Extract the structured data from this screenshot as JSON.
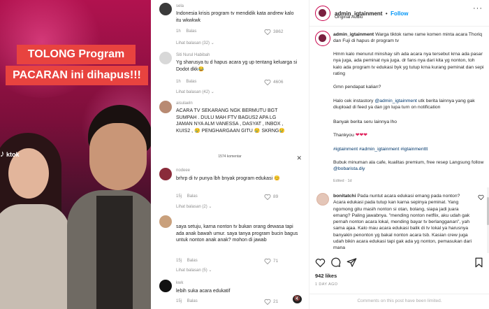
{
  "video": {
    "banner_line1": "TOLONG Program",
    "banner_line2": "PACARAN ini dihapus!!!",
    "tiktok_mark": "ktok",
    "colors": {
      "banner": "#e8433f",
      "background": "#b1124f"
    }
  },
  "comments": {
    "count_label": "1574 komentar",
    "reply_label": "Balas",
    "items": [
      {
        "user": "sela",
        "text": "Indonesia krisis program tv mendidik kata andrew kalo itu wkwkwk",
        "time": "1h",
        "likes": "3862",
        "replies": "Lihat balasan (32)"
      },
      {
        "user": "Siti Nurul Habibah",
        "text": "Yg sharusya tu d hapus acara yg up tentang keluarga si Dodot dkk😂",
        "time": "1h",
        "likes": "4606",
        "replies": "Lihat balasan (42)"
      },
      {
        "user": "aisulaeln",
        "text": "ACARA TV SEKARANG NGK BERMUTU BGT SUMPAH . DULU MAH FTV BAGUS2 APA LG JAMAN NYA ALM VANESSA , DASYAT , INBOX , KUIS2 , 😢 PENGHARGAAN GITU 😢 SKRNG😢",
        "time": "",
        "likes": "",
        "replies": ""
      },
      {
        "user": "nodeee",
        "text": "brhrp di tv punya lbh bnyak program edukasi 😊",
        "time": "15j",
        "likes": "89",
        "replies": "Lihat balasan (2)"
      },
      {
        "user": "",
        "text": "saya setuju, karna nonton tv bukan orang dewasa tapi ada anak bawah umur. saya tanya program bucin bagus untuk nonton anak anak? mohon di jawab",
        "time": "15j",
        "likes": "71",
        "replies": "Lihat balasan (5)"
      },
      {
        "user": "kwk",
        "text": "lebih suka acara edukatif",
        "time": "15j",
        "likes": "21",
        "replies": ""
      }
    ]
  },
  "post": {
    "username": "admin_igtainment",
    "follow_label": "Follow",
    "audio": "Original Audio",
    "caption_user": "admin_igtainment",
    "caption_lead": "Warga tiktok rame rame komen minta acara Thoriq dan Fuji di hapus dr program tv",
    "para1": "Hmm kalo menurut minshay sih ada acara nya tersebut krna ada pasar nya juga, ada peminat nya juga. dr fans nya dari kita yg nonton, toh kalo ada program tv edukasi byk yg tutup krna kurang peminat dan sepi rating",
    "para2": "Gmn pendapat kalian?",
    "para3_before": "Halo cek instastory ",
    "para3_link": "@admin_igtainment",
    "para3_after": " utk berita lainnya yang gak diupload di feed ya dan jgn lupa turn on notification",
    "para4": "Banyak berita seru lainnya lho",
    "thankyou": "Thankyou",
    "thankyou_hearts": "❤❤❤",
    "hashtags": "#igtainment #admin_igtainment #igtainmenttt",
    "promo_before": "Bubuk minuman ala cafe, kualitas premium, free resep Langsung follow ",
    "promo_link": "@bobarista.diy",
    "edited": "Edited · 1d",
    "reply_user": "bonitatchi",
    "reply_text": "Pada nuntut acara edukasi emang pada nonton? Acara edukasi pada tutup kan karna sepinya peminat. Yang ngomong gitu masih nonton si otan, bolang, siapa jadi juara emang? Paling jawabnya. \"mending nonton netflix, aku udah gak pernah nonton acara lokal, mending bayar tv berlangganan\", yah sama ajaa. Kalo mau acara edukasi balik di tv lokal ya harusnya banyakin penonton yg bakal nonton acara tsb. Kasian crew juga udah bikin acara edukasi tapi gak ada yg nonton, pemasukan dari mana",
    "likes": "942 likes",
    "time_ago": "1 DAY AGO",
    "limited": "Comments on this post have been limited.",
    "colors": {
      "follow": "#0095f6",
      "link": "#00376b"
    }
  }
}
